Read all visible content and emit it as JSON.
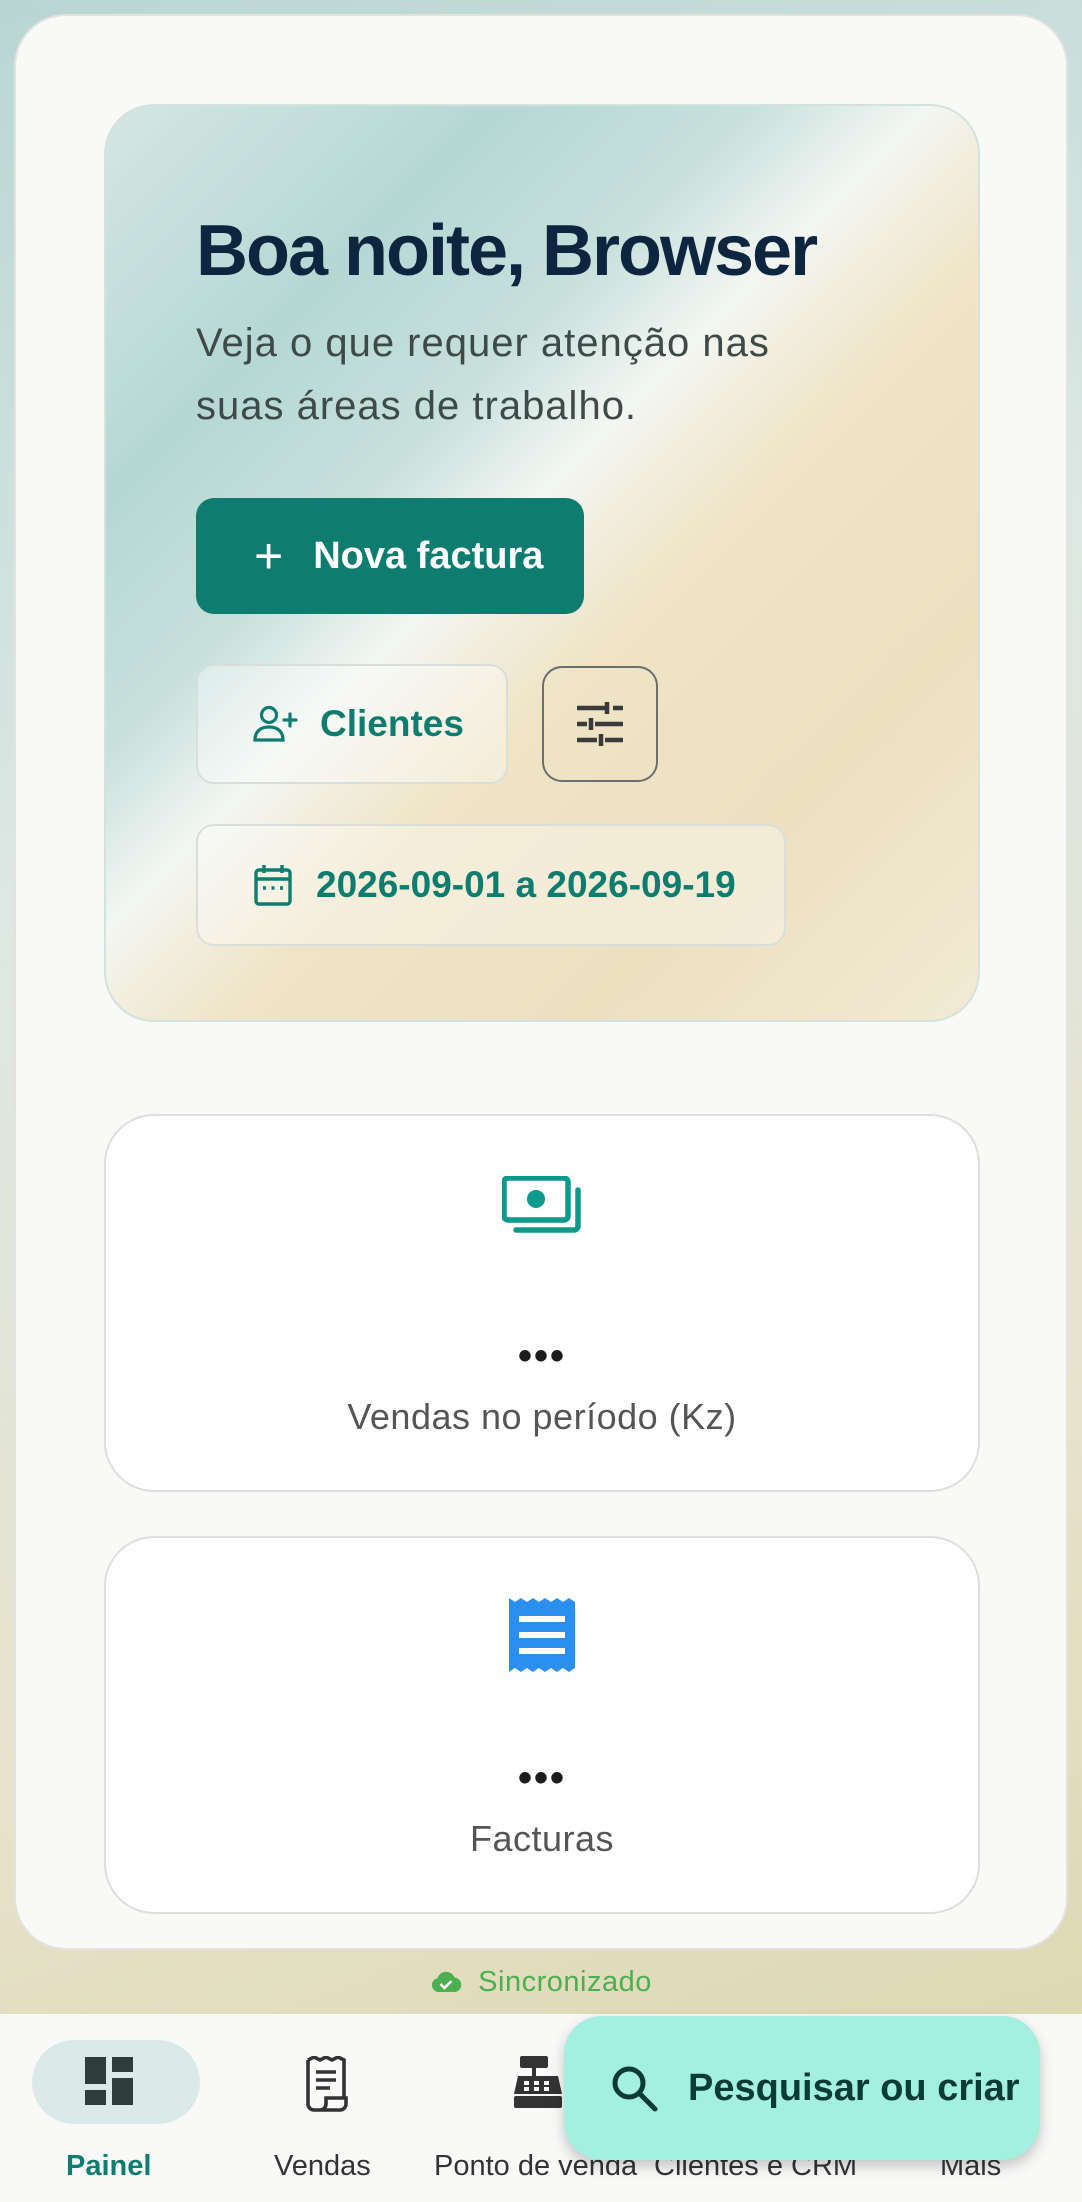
{
  "hero": {
    "greeting": "Boa noite, Browser",
    "subtitle": "Veja o que requer atenção nas suas áreas de trabalho.",
    "new_invoice_label": "Nova factura",
    "clients_label": "Clientes",
    "date_range": "2026-09-01 a 2026-09-19"
  },
  "stats": [
    {
      "value": "•••",
      "label": "Vendas no período (Kz)",
      "icon": "cash-icon",
      "color": "#0e9a8a"
    },
    {
      "value": "•••",
      "label": "Facturas",
      "icon": "receipt-icon",
      "color": "#2c8ff0"
    }
  ],
  "sync": {
    "status": "Sincronizado",
    "color": "#4caf50"
  },
  "nav": [
    {
      "label": "Painel",
      "icon": "dashboard-icon",
      "active": true
    },
    {
      "label": "Vendas",
      "icon": "receipt-long-icon",
      "active": false
    },
    {
      "label": "Ponto de venda",
      "icon": "cash-register-icon",
      "active": false
    },
    {
      "label": "Clientes e CRM",
      "icon": "people-icon",
      "active": false
    },
    {
      "label": "Mais",
      "icon": "more-icon",
      "active": false
    }
  ],
  "fab": {
    "label": "Pesquisar ou criar"
  },
  "colors": {
    "primary": "#0e7d6f",
    "fab": "#a3efe0",
    "title": "#0e2540"
  }
}
